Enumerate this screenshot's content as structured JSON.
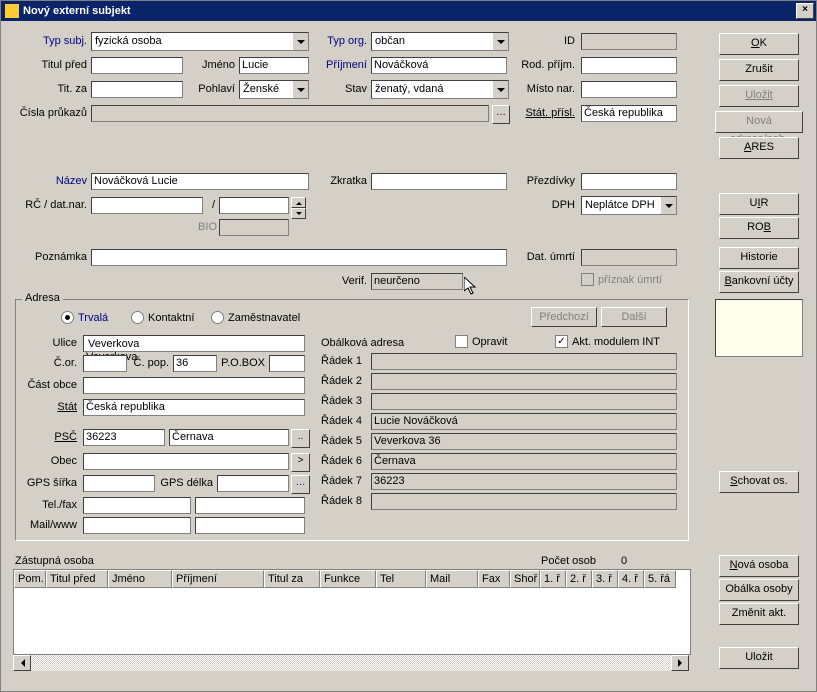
{
  "window": {
    "title": "Nový externí subjekt"
  },
  "buttons": {
    "ok": "OK",
    "cancel": "Zrušit",
    "save": "Uložit",
    "new_addr": "Nová adresa/pob.",
    "ares": "ARES",
    "uir": "UIR",
    "rob": "ROB",
    "history": "Historie",
    "bank": "Bankovní účty",
    "hide": "Schovat os.",
    "new_person": "Nová osoba",
    "env_person": "Obálka osoby",
    "change": "Změnit akt.",
    "save2": "Uložit",
    "prev": "Předchozí",
    "next": "Další"
  },
  "labels": {
    "typsubj": "Typ subj.",
    "typorg": "Typ org.",
    "id": "ID",
    "titulpred": "Titul před",
    "jmeno": "Jméno",
    "prijmeni": "Příjmení",
    "rodprijm": "Rod. příjm.",
    "titza": "Tit. za",
    "pohlavi": "Pohlaví",
    "stav": "Stav",
    "mistonar": "Místo nar.",
    "cisla": "Čísla průkazů",
    "statprisl": "Stát. přísl.",
    "nazev": "Název",
    "zkratka": "Zkratka",
    "prezdivky": "Přezdívky",
    "rcdat": "RČ / dat.nar.",
    "dph": "DPH",
    "bio": "BIO",
    "poznamka": "Poznámka",
    "datumrti": "Dat. úmrtí",
    "priznak": "příznak úmrtí",
    "verif": "Verif.",
    "adresa": "Adresa",
    "trvala": "Trvalá",
    "kontaktni": "Kontaktní",
    "zamestnavatel": "Zaměstnavatel",
    "ulice": "Ulice",
    "cor": "Č.or.",
    "cpop": "Č. pop.",
    "pobox": "P.O.BOX",
    "castobce": "Část obce",
    "stat": "Stát",
    "psc": "PSČ",
    "obec": "Obec",
    "gpssirka": "GPS šířka",
    "gpsdelka": "GPS délka",
    "telfax": "Tel./fax",
    "mailwww": "Mail/www",
    "obalkova": "Obálková adresa",
    "opravit": "Opravit",
    "aktmodul": "Akt. modulem INT",
    "radek1": "Řádek 1",
    "radek2": "Řádek 2",
    "radek3": "Řádek 3",
    "radek4": "Řádek 4",
    "radek5": "Řádek 5",
    "radek6": "Řádek 6",
    "radek7": "Řádek 7",
    "radek8": "Řádek 8",
    "zastupna": "Zástupná osoba",
    "pocet": "Počet osob",
    "pocetval": "0"
  },
  "values": {
    "typsubj": "fyzická osoba",
    "typorg": "občan",
    "id": "",
    "titulpred": "",
    "jmeno": "Lucie",
    "prijmeni": "Nováčková",
    "rodprijm": "",
    "titza": "",
    "pohlavi": "Ženské",
    "stav": "ženatý, vdaná",
    "mistonar": "",
    "cisla": "",
    "statprisl": "Česká republika",
    "nazev": "Nováčková Lucie",
    "zkratka": "",
    "prezdivky": "",
    "rc": "",
    "dph": "Neplátce DPH",
    "bio": "",
    "poznamka": "",
    "datumrti": "",
    "verif": "neurčeno",
    "ulice": "Veverkova",
    "cor": "",
    "cpop": "36",
    "pobox": "",
    "castobce": "",
    "stat": "Česká republika",
    "psc": "36223",
    "psc_obec": "Černava",
    "obec": "",
    "gpssirka": "",
    "gpsdelka": "",
    "tel1": "",
    "tel2": "",
    "mail1": "",
    "mail2": "",
    "r1": "",
    "r2": "",
    "r3": "",
    "r4": "Lucie Nováčková",
    "r5": "Veverkova 36",
    "r6": "Černava",
    "r7": "36223",
    "r8": ""
  },
  "columns": [
    "Pom.",
    "Titul před",
    "Jméno",
    "Příjmení",
    "Titul za",
    "Funkce",
    "Tel",
    "Mail",
    "Fax",
    "Shoř",
    "1. ř",
    "2. ř",
    "3. ř",
    "4. ř",
    "5. řá"
  ]
}
